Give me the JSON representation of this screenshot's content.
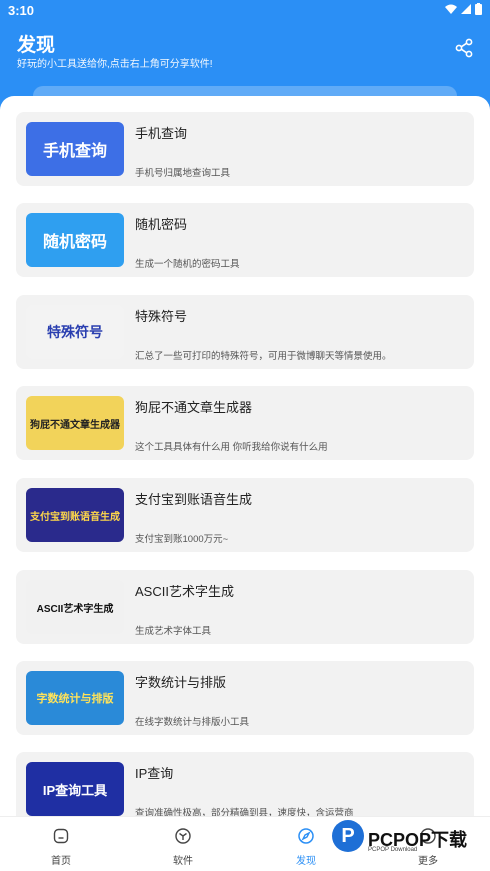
{
  "status_bar": {
    "time": "3:10"
  },
  "header": {
    "title": "发现",
    "subtitle": "好玩的小工具送给你,点击右上角可分享软件!",
    "share_icon": "share-icon",
    "background": "#2b8ff5"
  },
  "tools": [
    {
      "title": "手机查询",
      "desc": "手机号归属地查询工具",
      "thumb_text": "手机查询",
      "thumb_color": "#3d6fe6"
    },
    {
      "title": "随机密码",
      "desc": "生成一个随机的密码工具",
      "thumb_text": "随机密码",
      "thumb_color": "#2f9ff0"
    },
    {
      "title": "特殊符号",
      "desc": "汇总了一些可打印的特殊符号，可用于微博聊天等情景使用。",
      "thumb_text": "特殊符号",
      "thumb_color": "#f3f3f3"
    },
    {
      "title": "狗屁不通文章生成器",
      "desc": "这个工具具体有什么用 你听我给你说有什么用",
      "thumb_text": "狗屁不通文章生成器",
      "thumb_color": "#f2d35a"
    },
    {
      "title": "支付宝到账语音生成",
      "desc": "支付宝到账1000万元~",
      "thumb_text": "支付宝到账语音生成",
      "thumb_color": "#2a2a8c"
    },
    {
      "title": "ASCII艺术字生成",
      "desc": "生成艺术字体工具",
      "thumb_text": "ASCII艺术字生成",
      "thumb_color": "#f1f1f1"
    },
    {
      "title": "字数统计与排版",
      "desc": "在线字数统计与排版小工具",
      "thumb_text": "字数统计与排版",
      "thumb_color": "#2a8ad8"
    },
    {
      "title": "IP查询",
      "desc": "查询准确性极高，部分精确到县，速度快，含运营商",
      "thumb_text": "IP查询工具",
      "thumb_color": "#1f2fa3"
    }
  ],
  "nav": [
    {
      "label": "首页",
      "icon": "home-icon"
    },
    {
      "label": "软件",
      "icon": "app-icon"
    },
    {
      "label": "发现",
      "icon": "compass-icon",
      "active": true
    },
    {
      "label": "更多",
      "icon": "more-icon"
    }
  ],
  "watermark": {
    "brand": "PCPOP下载",
    "sub": "PCPOP Download"
  },
  "colors": {
    "accent": "#2b8ff5",
    "card": "#f2f2f2"
  }
}
